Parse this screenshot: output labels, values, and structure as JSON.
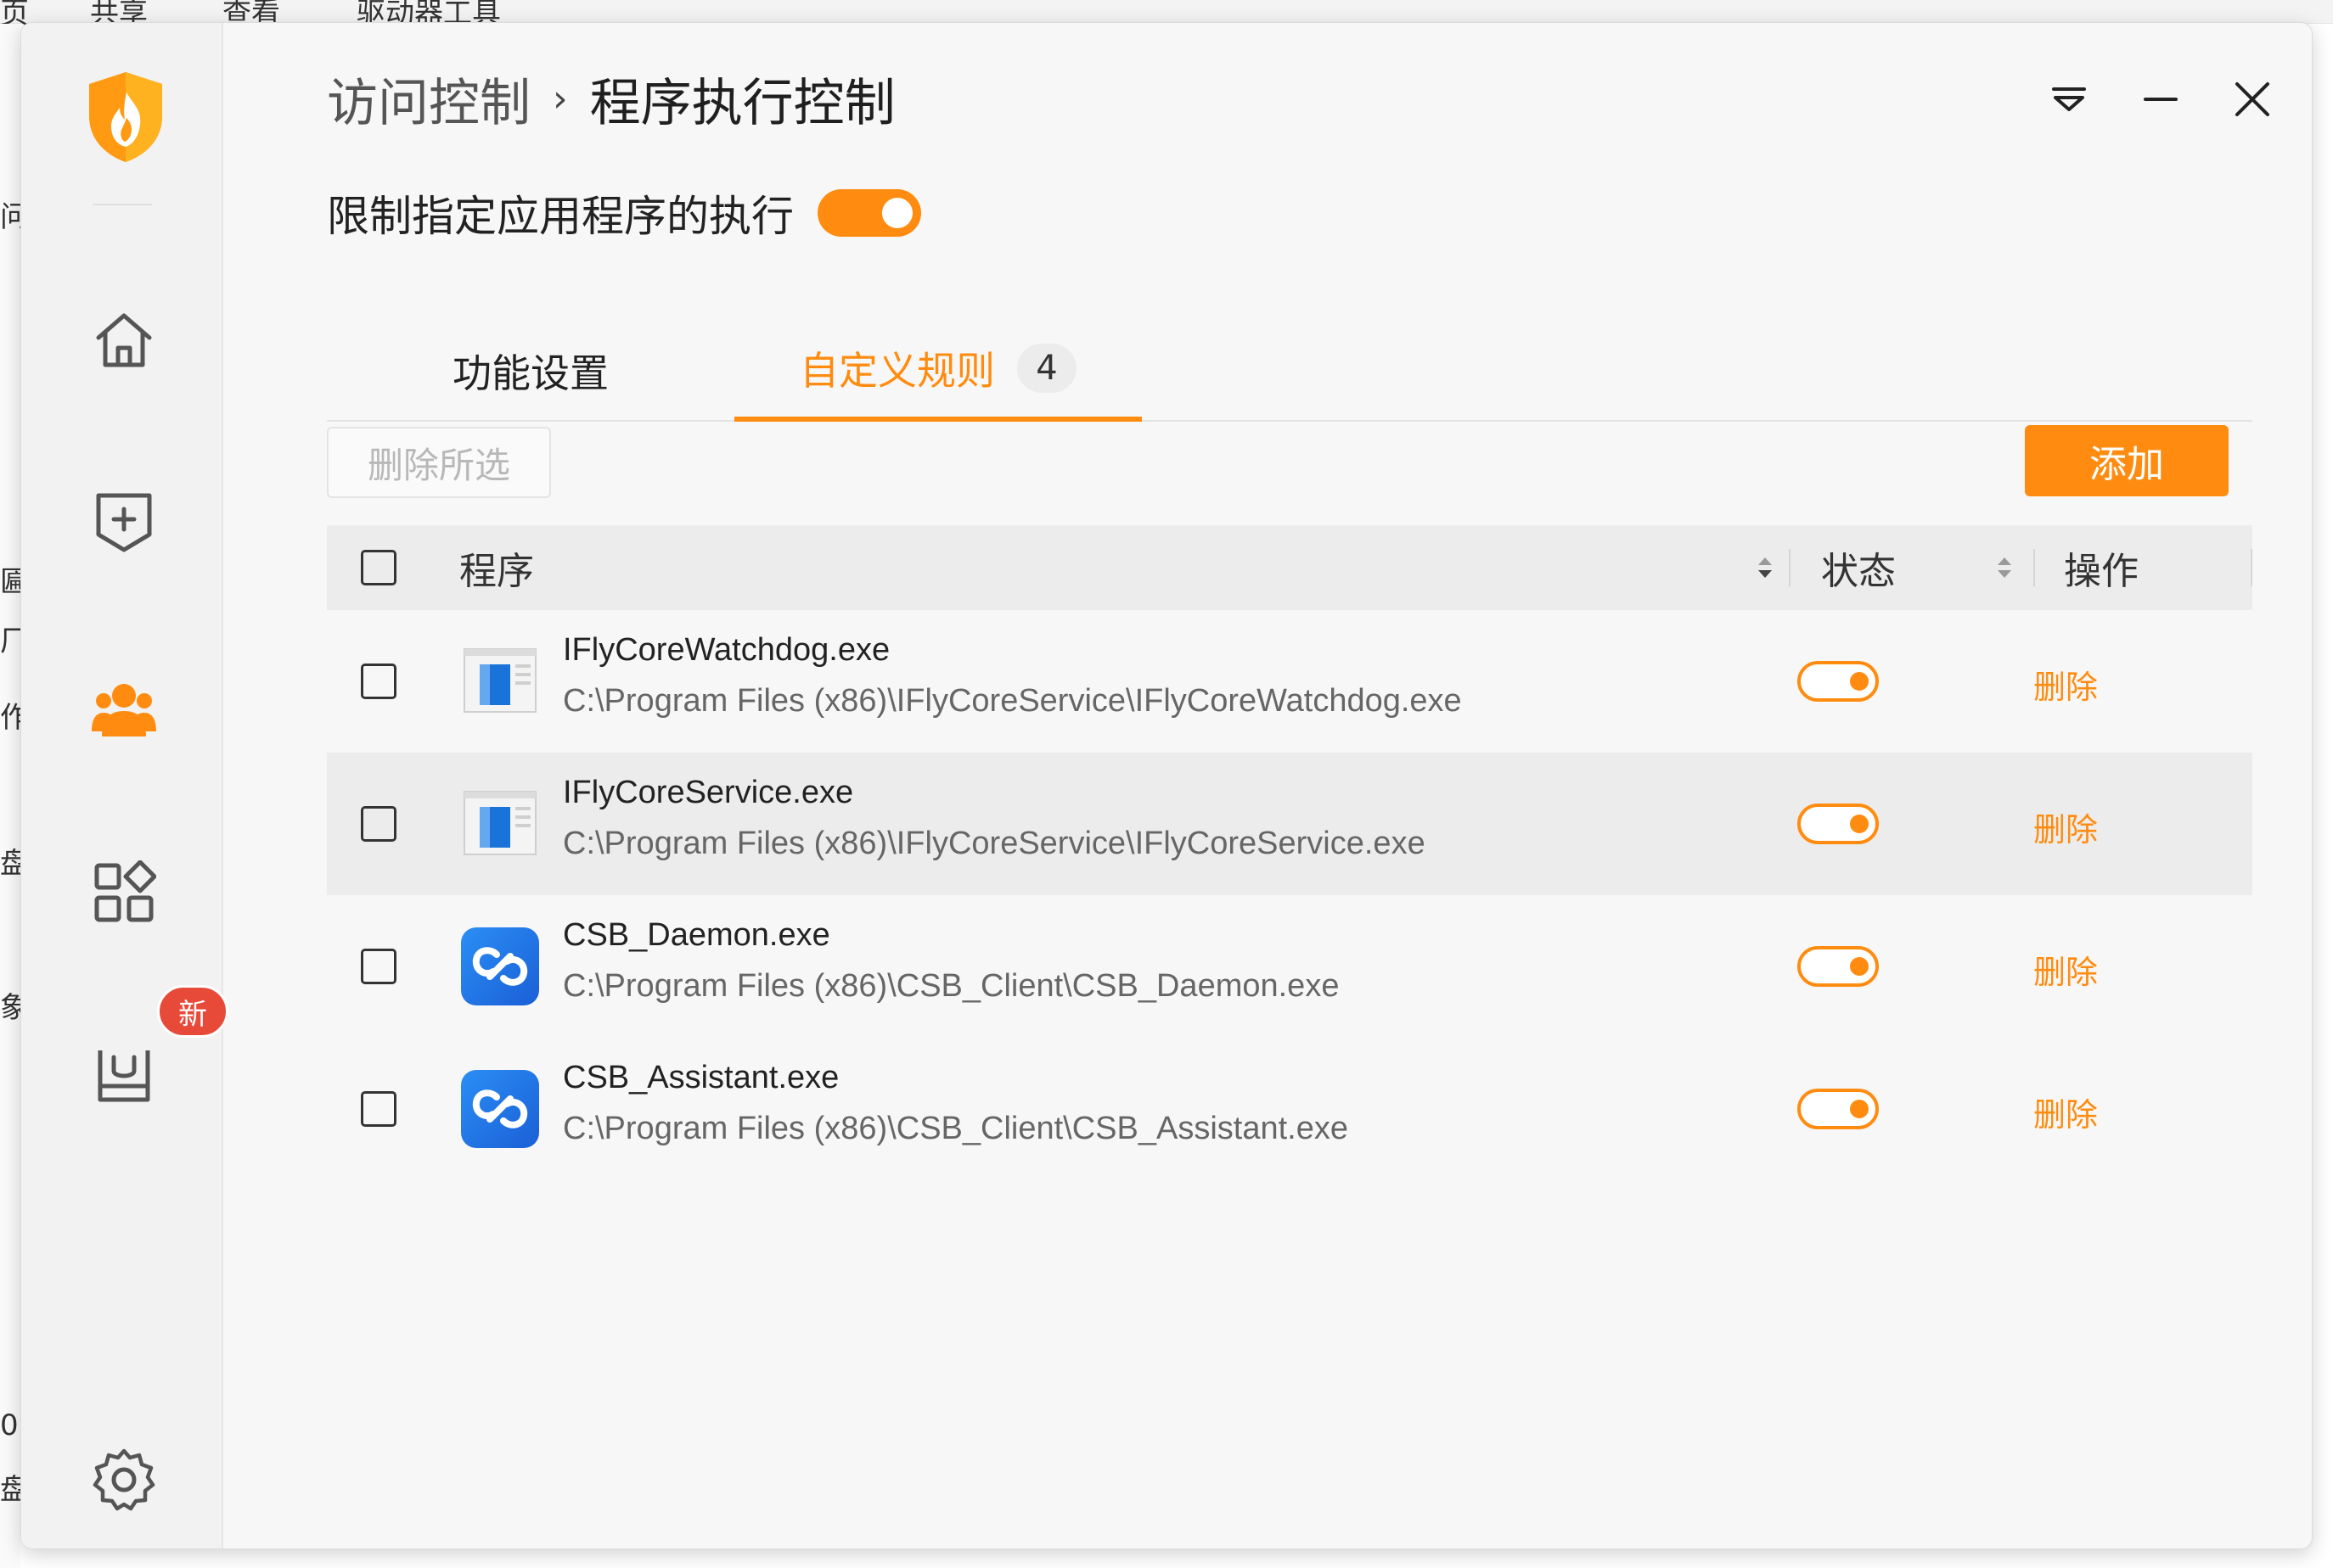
{
  "background": {
    "menu": [
      "共享",
      "查看",
      "驱动器工具"
    ],
    "side_fragments": [
      "问",
      "匾",
      "厂",
      "作",
      "盘",
      "象",
      "0",
      "盘"
    ]
  },
  "breadcrumb": {
    "parent": "访问控制",
    "separator": "›",
    "current": "程序执行控制"
  },
  "restrict": {
    "label": "限制指定应用程序的执行",
    "enabled": true
  },
  "tabs": [
    {
      "label": "功能设置",
      "active": false
    },
    {
      "label": "自定义规则",
      "active": true,
      "count": "4"
    }
  ],
  "toolbar": {
    "delete_selected": "删除所选",
    "add": "添加"
  },
  "table": {
    "headers": {
      "program": "程序",
      "status": "状态",
      "action": "操作"
    },
    "rows": [
      {
        "name": "IFlyCoreWatchdog.exe",
        "path": "C:\\Program Files (x86)\\IFlyCoreService\\IFlyCoreWatchdog.exe",
        "icon": "window-app-icon",
        "enabled": true,
        "action": "删除"
      },
      {
        "name": "IFlyCoreService.exe",
        "path": "C:\\Program Files (x86)\\IFlyCoreService\\IFlyCoreService.exe",
        "icon": "window-app-icon",
        "enabled": true,
        "action": "删除"
      },
      {
        "name": "CSB_Daemon.exe",
        "path": "C:\\Program Files (x86)\\CSB_Client\\CSB_Daemon.exe",
        "icon": "csb-link-icon",
        "enabled": true,
        "action": "删除"
      },
      {
        "name": "CSB_Assistant.exe",
        "path": "C:\\Program Files (x86)\\CSB_Client\\CSB_Assistant.exe",
        "icon": "csb-link-icon",
        "enabled": true,
        "action": "删除"
      }
    ]
  },
  "sidebar": {
    "items": [
      {
        "icon": "home-icon"
      },
      {
        "icon": "shield-plus-icon"
      },
      {
        "icon": "users-icon",
        "active": true
      },
      {
        "icon": "apps-grid-icon"
      },
      {
        "icon": "toolbox-icon",
        "badge": "新"
      },
      {
        "icon": "settings-gear-icon"
      }
    ]
  },
  "colors": {
    "accent": "#ff8c10",
    "badge": "#e84a3a"
  }
}
